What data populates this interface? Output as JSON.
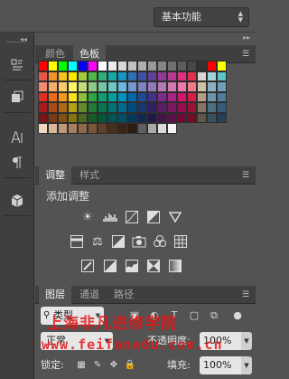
{
  "workspace": {
    "label": "基本功能"
  },
  "color_panel": {
    "tabs": [
      {
        "label": "颜色",
        "active": false
      },
      {
        "label": "色板",
        "active": true
      }
    ],
    "swatch_rows": [
      [
        "#ff0000",
        "#ffff00",
        "#00ff00",
        "#00ffff",
        "#0000ff",
        "#ff00ff",
        "#ffffff",
        "#ebebeb",
        "#d6d6d6",
        "#c2c2c2",
        "#adadad",
        "#999999",
        "#858585",
        "#707070",
        "#5c5c5c",
        "#474747",
        "#333333",
        "#ff0000",
        "#ffff00"
      ],
      [
        "#e8584b",
        "#f2922e",
        "#f7c21b",
        "#ffe800",
        "#9fcb3c",
        "#4cb848",
        "#2db07a",
        "#17a8a5",
        "#1597c9",
        "#2c72b8",
        "#3f51a3",
        "#5e3f99",
        "#8f3b97",
        "#b73893",
        "#e12e86",
        "#e42e4e",
        "#dfd5d0",
        "#9fd4de",
        "#5cc3c8"
      ],
      [
        "#f08c74",
        "#f5ad6b",
        "#f9cc6a",
        "#fff56b",
        "#c3dd7a",
        "#8fcb86",
        "#74c6a2",
        "#6ccac6",
        "#6ab8e0",
        "#7398d0",
        "#7f82bf",
        "#9179b6",
        "#b279b5",
        "#d178b3",
        "#ee77ab",
        "#ef7b86",
        "#cfc0a8",
        "#8ab2c0",
        "#6f9fbd"
      ],
      [
        "#e22d24",
        "#ec6a1c",
        "#f39a18",
        "#fbe21c",
        "#8dbf3c",
        "#30a546",
        "#0ca06e",
        "#00a19a",
        "#0093c4",
        "#0068ad",
        "#1e4a98",
        "#43328b",
        "#7d2a89",
        "#a82483",
        "#d3156f",
        "#d81b47",
        "#b49f86",
        "#6b96ab",
        "#4c7ea4"
      ],
      [
        "#a51d1f",
        "#a84a19",
        "#ab6c12",
        "#b3a015",
        "#658a2c",
        "#217a35",
        "#077650",
        "#007570",
        "#006b8f",
        "#004c80",
        "#16376f",
        "#301f66",
        "#5b1d65",
        "#7b1962",
        "#990d50",
        "#9c1234",
        "#857565",
        "#4d6f7f",
        "#365c79"
      ],
      [
        "#7b1517",
        "#7d3814",
        "#80520f",
        "#857710",
        "#4b6721",
        "#175a27",
        "#04573b",
        "#005753",
        "#00506a",
        "#00385f",
        "#0f2952",
        "#23164b",
        "#43144a",
        "#5b1148",
        "#72093c",
        "#740d26",
        "#625649",
        "#38525d",
        "#273f58"
      ],
      [
        "#f2d7bf",
        "#d9b79a",
        "#bf987b",
        "#a8805f",
        "#8f6a4a",
        "#7a5538",
        "#5f3f28",
        "#4a2f1b",
        "#3b2414",
        "#2d1b0f",
        "#5e5e5e",
        "#a9a9a9",
        "#d9d9d9",
        "#f5f5f5"
      ]
    ]
  },
  "adjustments_panel": {
    "tabs": [
      {
        "label": "调整",
        "active": true
      },
      {
        "label": "样式",
        "active": false
      }
    ],
    "title": "添加调整"
  },
  "layers_panel": {
    "tabs": [
      {
        "label": "图层",
        "active": true
      },
      {
        "label": "通道",
        "active": false
      },
      {
        "label": "路径",
        "active": false
      }
    ],
    "filter_label": "类型",
    "blend_mode": "正常",
    "opacity_label": "不透明度:",
    "opacity_value": "100%",
    "lock_label": "锁定:",
    "fill_label": "填充:",
    "fill_value": "100%"
  },
  "watermark": {
    "line1": "上海非凡进修学院",
    "line2": "www.feifanedu.com.cn"
  },
  "colors": {
    "panel_bg": "#535353",
    "dock_bg": "#3f3f3f",
    "accent_red": "#e61414"
  }
}
